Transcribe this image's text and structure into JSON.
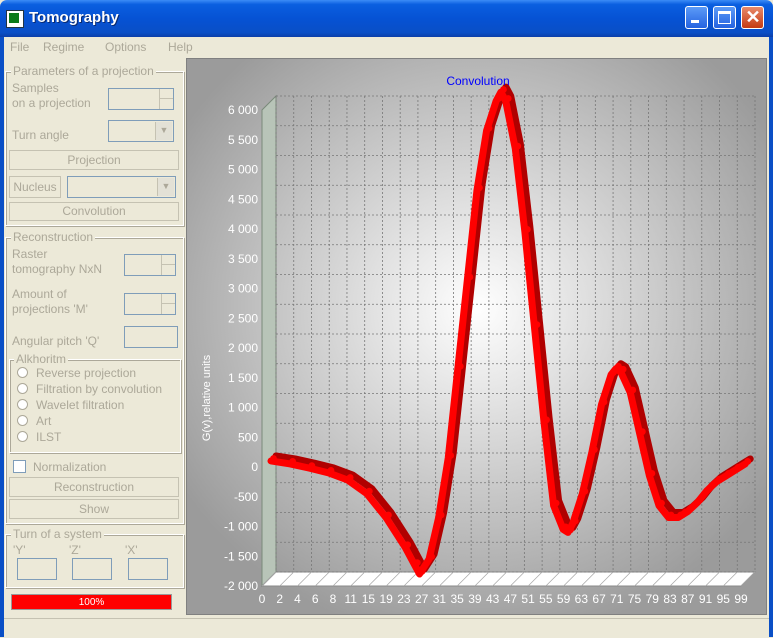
{
  "window": {
    "title": "Tomography"
  },
  "menu": [
    {
      "label": "File"
    },
    {
      "label": "Regime"
    },
    {
      "label": "Options"
    },
    {
      "label": "Help"
    }
  ],
  "projection_params": {
    "legend": "Parameters of a projection",
    "samples_label_1": "Samples",
    "samples_label_2": "on a projection",
    "turn_angle_label": "Turn angle",
    "projection_button": "Projection",
    "nucleus_button": "Nucleus",
    "convolution_button": "Convolution"
  },
  "reconstruction": {
    "legend": "Reconstruction",
    "raster_label_1": "Raster",
    "raster_label_2": "tomography NxN",
    "amount_label_1": "Amount of",
    "amount_label_2": "projections 'M'",
    "angular_label": "Angular pitch 'Q'",
    "algorithm_legend": "Alkhoritm",
    "algorithms": [
      "Reverse projection",
      "Filtration by convolution",
      "Wavelet filtration",
      "Art",
      "ILST"
    ],
    "normalization_label": "Normalization",
    "reconstruction_button": "Reconstruction",
    "show_button": "Show"
  },
  "turn": {
    "legend": "Turn of a system",
    "labels": [
      "'Y'",
      "'Z'",
      "'X'"
    ]
  },
  "progress": {
    "value": 100,
    "text": "100%"
  },
  "colors": {
    "series": "#ff0000",
    "title": "#0000ff",
    "axis_text": "#ffffff",
    "titlebar": "#0a4fc6"
  },
  "chart_data": {
    "type": "line",
    "title": "Convolution",
    "ylabel": "G(v),relative units",
    "xlabel": "",
    "ylim": [
      -2000,
      6000
    ],
    "xlim": [
      0,
      100
    ],
    "yticks": [
      -2000,
      -1500,
      -1000,
      -500,
      0,
      500,
      1000,
      1500,
      2000,
      2500,
      3000,
      3500,
      4000,
      4500,
      5000,
      5500,
      6000
    ],
    "ytick_labels": [
      "-2 000",
      "-1 500",
      "-1 000",
      "-500",
      "0",
      "500",
      "1 000",
      "1 500",
      "2 000",
      "2 500",
      "3 000",
      "3 500",
      "4 000",
      "4 500",
      "5 000",
      "5 500",
      "6 000"
    ],
    "xtick_labels": [
      "0",
      "2",
      "4",
      "6",
      "8",
      "11",
      "15",
      "19",
      "23",
      "27",
      "31",
      "35",
      "39",
      "43",
      "47",
      "51",
      "55",
      "59",
      "63",
      "67",
      "71",
      "75",
      "79",
      "83",
      "87",
      "91",
      "95",
      "99"
    ],
    "grid": true,
    "series": [
      {
        "x": [
          0,
          4,
          8,
          12,
          16,
          20,
          24,
          28,
          30,
          31,
          33,
          35,
          37,
          39,
          41,
          43,
          45,
          47,
          48,
          49,
          51,
          53,
          55,
          57,
          59,
          61,
          62,
          63,
          65,
          67,
          69,
          71,
          72,
          73,
          75,
          77,
          79,
          81,
          83,
          85,
          86,
          87,
          89,
          91,
          93,
          95,
          97,
          99
        ],
        "y": [
          -50,
          -100,
          -170,
          -250,
          -370,
          -600,
          -1000,
          -1500,
          -1800,
          -1950,
          -1700,
          -1000,
          0,
          1500,
          3000,
          4500,
          5500,
          6000,
          6150,
          6000,
          5200,
          3800,
          2200,
          600,
          -800,
          -1200,
          -1250,
          -1100,
          -600,
          100,
          900,
          1400,
          1500,
          1450,
          1100,
          400,
          -300,
          -800,
          -1000,
          -1000,
          -950,
          -900,
          -750,
          -550,
          -400,
          -300,
          -200,
          -100
        ]
      }
    ]
  }
}
